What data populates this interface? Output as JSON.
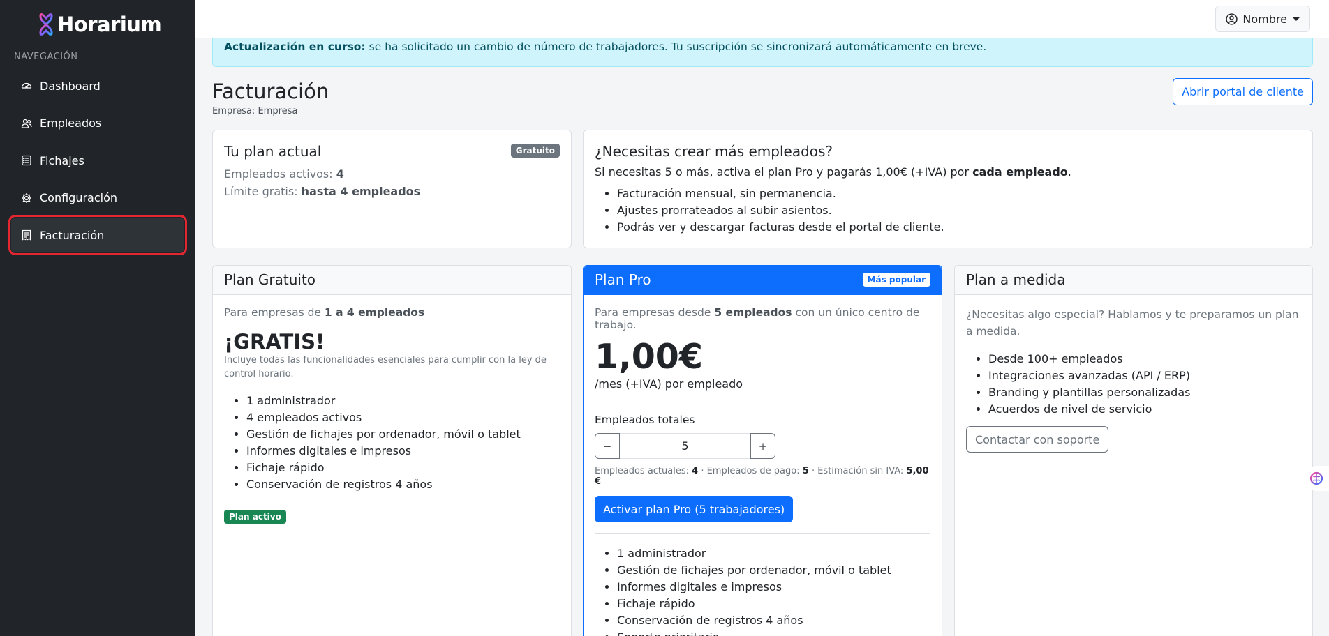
{
  "app": {
    "name": "Horarium"
  },
  "sidebar": {
    "heading": "NAVEGACIÓN",
    "items": [
      {
        "label": "Dashboard",
        "icon": "speedometer-icon"
      },
      {
        "label": "Empleados",
        "icon": "people-icon"
      },
      {
        "label": "Fichajes",
        "icon": "card-list-icon"
      },
      {
        "label": "Configuración",
        "icon": "gear-icon"
      },
      {
        "label": "Facturación",
        "icon": "receipt-icon",
        "active": true
      }
    ]
  },
  "topbar": {
    "user_label": "Nombre"
  },
  "alert": {
    "strong": "Actualización en curso:",
    "text": "se ha solicitado un cambio de número de trabajadores. Tu suscripción se sincronizará automáticamente en breve."
  },
  "page": {
    "title": "Facturación",
    "subtitle": "Empresa: Empresa",
    "portal_button": "Abrir portal de cliente"
  },
  "current_plan": {
    "title": "Tu plan actual",
    "badge": "Gratuito",
    "active_label": "Empleados activos:",
    "active_value": "4",
    "limit_label": "Límite gratis:",
    "limit_value": "hasta 4 empleados"
  },
  "more_employees": {
    "title": "¿Necesitas crear más empleados?",
    "text_before": "Si necesitas 5 o más, activa el plan Pro y pagarás 1,00€ (+IVA) por",
    "text_strong": "cada empleado",
    "text_after": ".",
    "bullets": [
      "Facturación mensual, sin permanencia.",
      "Ajustes prorrateados al subir asientos.",
      "Podrás ver y descargar facturas desde el portal de cliente."
    ]
  },
  "plan_free": {
    "title": "Plan Gratuito",
    "desc_before": "Para empresas de",
    "desc_strong": "1 a 4 empleados",
    "price": "¡GRATIS!",
    "note": "Incluye todas las funcionalidades esenciales para cumplir con la ley de control horario.",
    "features": [
      "1 administrador",
      "4 empleados activos",
      "Gestión de fichajes por ordenador, móvil o tablet",
      "Informes digitales e impresos",
      "Fichaje rápido",
      "Conservación de registros 4 años"
    ],
    "status_badge": "Plan activo"
  },
  "plan_pro": {
    "title": "Plan Pro",
    "badge": "Más popular",
    "desc_before": "Para empresas desde",
    "desc_strong": "5 empleados",
    "desc_after": "con un único centro de trabajo.",
    "price": "1,00€",
    "price_unit": "/mes (+IVA) por empleado",
    "stepper_label": "Empleados totales",
    "stepper_minus": "−",
    "stepper_value": "5",
    "stepper_plus": "+",
    "summary_current_label": "Empleados actuales:",
    "summary_current": "4",
    "summary_paid_label": "· Empleados de pago:",
    "summary_paid": "5",
    "summary_est_label": "· Estimación sin IVA:",
    "summary_est": "5,00 €",
    "activate_button": "Activar plan Pro (5 trabajadores)",
    "features": [
      "1 administrador",
      "Gestión de fichajes por ordenador, móvil o tablet",
      "Informes digitales e impresos",
      "Fichaje rápido",
      "Conservación de registros 4 años",
      "Soporte prioritario"
    ]
  },
  "plan_custom": {
    "title": "Plan a medida",
    "desc": "¿Necesitas algo especial? Hablamos y te preparamos un plan a medida.",
    "features": [
      "Desde 100+ empleados",
      "Integraciones avanzadas (API / ERP)",
      "Branding y plantillas personalizadas",
      "Acuerdos de nivel de servicio"
    ],
    "contact_button": "Contactar con soporte"
  },
  "colors": {
    "sidebar_bg": "#212529",
    "primary": "#0d6efd",
    "alert_bg": "#cff4fc",
    "success": "#198754",
    "highlight": "#e3262f"
  }
}
